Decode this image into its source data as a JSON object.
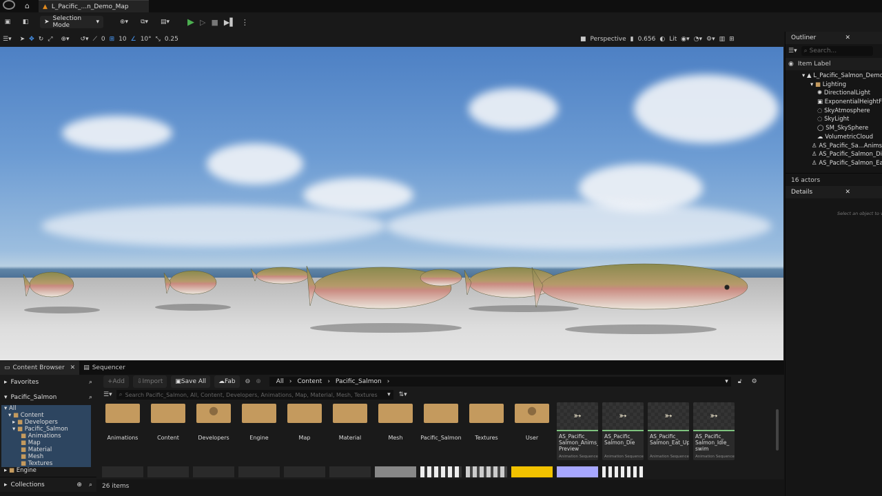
{
  "titlebar": {
    "tab_label": "L_Pacific_...n_Demo_Map"
  },
  "toolbar": {
    "selection_mode": "Selection Mode"
  },
  "viewport_bar": {
    "angle_snap": "0",
    "grid_snap": "10",
    "rot_snap": "10°",
    "scale_snap": "0.25",
    "view_mode": "Perspective",
    "fov": "0.656",
    "lit": "Lit"
  },
  "outliner": {
    "title": "Outliner",
    "search_placeholder": "Search...",
    "column": "Item Label",
    "items": [
      "L_Pacific_Salmon_Demo_",
      "Lighting",
      "DirectionalLight",
      "ExponentialHeightFog",
      "SkyAtmosphere",
      "SkyLight",
      "SM_SkySphere",
      "VolumetricCloud",
      "AS_Pacific_Sa...Anims_P",
      "AS_Pacific_Salmon_Die",
      "AS_Pacific_Salmon_Eat"
    ],
    "actor_count": "16 actors"
  },
  "details": {
    "title": "Details",
    "hint": "Select an object to vi"
  },
  "content_browser": {
    "tab": "Content Browser",
    "tab2": "Sequencer",
    "favorites": "Favorites",
    "root": "Pacific_Salmon",
    "tree": [
      "All",
      "Content",
      "Developers",
      "Pacific_Salmon",
      "Animations",
      "Map",
      "Material",
      "Mesh",
      "Textures",
      "Engine"
    ],
    "collections": "Collections",
    "add": "Add",
    "import": "Import",
    "save_all": "Save All",
    "fab": "Fab",
    "path": [
      "All",
      "Content",
      "Pacific_Salmon"
    ],
    "search_placeholder": "Search Pacific_Salmon, All, Content, Developers, Animations, Map, Material, Mesh, Textures",
    "folders": [
      "Animations",
      "Content",
      "Developers",
      "Engine",
      "Map",
      "Material",
      "Mesh",
      "Pacific_Salmon",
      "Textures",
      "User"
    ],
    "assets": [
      {
        "name": "AS_Pacific_ Salmon_Anims_ Preview",
        "kind": "Animation Sequence"
      },
      {
        "name": "AS_Pacific_ Salmon_Die",
        "kind": "Animation Sequence"
      },
      {
        "name": "AS_Pacific_ Salmon_Eat_Up",
        "kind": "Animation Sequence"
      },
      {
        "name": "AS_Pacific_ Salmon_Idle_ swim",
        "kind": "Animation Sequence"
      }
    ],
    "item_count": "26 items"
  },
  "colors": {
    "accent_green": "#7ec37e",
    "play_green": "#4caf50",
    "folder": "#c49a5e"
  }
}
